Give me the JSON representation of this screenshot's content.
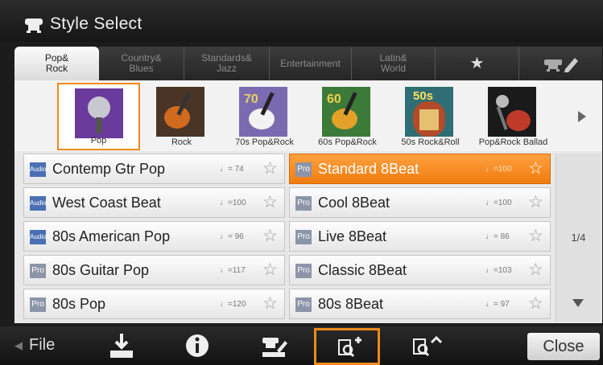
{
  "window": {
    "title": "Style Select"
  },
  "tabs": [
    {
      "line1": "Pop&",
      "line2": "Rock",
      "active": true
    },
    {
      "line1": "Country&",
      "line2": "Blues",
      "active": false
    },
    {
      "line1": "Standards&",
      "line2": "Jazz",
      "active": false
    },
    {
      "line1": "Entertainment",
      "line2": "",
      "active": false
    },
    {
      "line1": "Latin&",
      "line2": "World",
      "active": false
    },
    {
      "line1": "★",
      "line2": "",
      "active": false,
      "icon": "star-icon"
    },
    {
      "line1": "",
      "line2": "",
      "active": false,
      "icon": "user-edit-icon"
    }
  ],
  "categories": [
    {
      "label": "Pop",
      "icon": "microphone-icon",
      "selected": true
    },
    {
      "label": "Rock",
      "icon": "guitar-amp-icon",
      "selected": false
    },
    {
      "label": "70s Pop&Rock",
      "icon": "guitar-70-icon",
      "badge": "70",
      "selected": false
    },
    {
      "label": "60s Pop&Rock",
      "icon": "guitar-60-icon",
      "badge": "60",
      "selected": false
    },
    {
      "label": "50s Rock&Roll",
      "icon": "jukebox-50s-icon",
      "badge": "50s",
      "selected": false
    },
    {
      "label": "Pop&Rock Ballad",
      "icon": "mic-guitar-icon",
      "selected": false
    }
  ],
  "styles": [
    {
      "type": "Audio",
      "name": "Contemp Gtr Pop",
      "tempo": "♩= 74",
      "selected": false
    },
    {
      "type": "Audio",
      "name": "West Coast Beat",
      "tempo": "♩=100",
      "selected": false
    },
    {
      "type": "Audio",
      "name": "80s American Pop",
      "tempo": "♩= 96",
      "selected": false
    },
    {
      "type": "Pro",
      "name": "80s Guitar Pop",
      "tempo": "♩=117",
      "selected": false
    },
    {
      "type": "Pro",
      "name": "80s Pop",
      "tempo": "♩=120",
      "selected": false
    },
    {
      "type": "Pro",
      "name": "Standard 8Beat",
      "tempo": "♩=100",
      "selected": true
    },
    {
      "type": "Pro",
      "name": "Cool 8Beat",
      "tempo": "♩=100",
      "selected": false
    },
    {
      "type": "Pro",
      "name": "Live 8Beat",
      "tempo": "♩= 86",
      "selected": false
    },
    {
      "type": "Pro",
      "name": "Classic 8Beat",
      "tempo": "♩=103",
      "selected": false
    },
    {
      "type": "Pro",
      "name": "80s 8Beat",
      "tempo": "♩= 97",
      "selected": false
    }
  ],
  "pager": {
    "page": "1/4"
  },
  "bottom": {
    "file_label": "File",
    "close_label": "Close",
    "icons": [
      "save-icon",
      "info-icon",
      "user-edit-icon",
      "search-add-icon",
      "search-back-icon"
    ]
  },
  "colors": {
    "accent": "#f08a1a",
    "audio_badge": "#4a6fb5",
    "pro_badge": "#8c95a8"
  }
}
